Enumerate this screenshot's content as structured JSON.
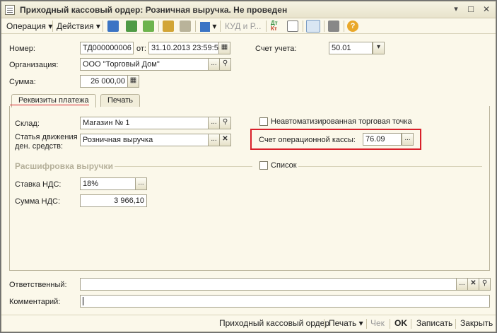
{
  "window": {
    "title": "Приходный кассовый ордер: Розничная выручка. Не проведен"
  },
  "toolbar": {
    "operation": "Операция",
    "actions": "Действия",
    "kud": "КУД и Р...",
    "dtkt_top": "Дт",
    "dtkt_bottom": "Кт"
  },
  "header": {
    "number_label": "Номер:",
    "number_value": "ТД000000006",
    "date_label": "от:",
    "date_value": "31.10.2013 23:59:59",
    "account_label": "Счет учета:",
    "account_value": "50.01",
    "org_label": "Организация:",
    "org_value": "ООО \"Торговый Дом\"",
    "sum_label": "Сумма:",
    "sum_value": "26 000,00"
  },
  "tabs": [
    {
      "label": "Реквизиты платежа",
      "active": true
    },
    {
      "label": "Печать",
      "active": false
    }
  ],
  "payment": {
    "warehouse_label": "Склад:",
    "warehouse_value": "Магазин № 1",
    "flow_label_1": "Статья движения",
    "flow_label_2": "ден. средств:",
    "flow_value": "Розничная выручка",
    "nonauto_label": "Неавтоматизированная торговая точка",
    "cashacc_label": "Счет операционной кассы:",
    "cashacc_value": "76.09",
    "section_title": "Расшифровка выручки",
    "list_label": "Список",
    "vat_rate_label": "Ставка НДС:",
    "vat_rate_value": "18%",
    "vat_sum_label": "Сумма НДС:",
    "vat_sum_value": "3 966,10"
  },
  "footer_fields": {
    "responsible_label": "Ответственный:",
    "responsible_value": "",
    "comment_label": "Комментарий:",
    "comment_value": ""
  },
  "bottom": {
    "print_form": "Приходный кассовый ордер",
    "print": "Печать",
    "check": "Чек",
    "ok": "OK",
    "save": "Записать",
    "close": "Закрыть"
  },
  "colors": {
    "highlight": "#d8202a",
    "background": "#fbf8ea"
  }
}
